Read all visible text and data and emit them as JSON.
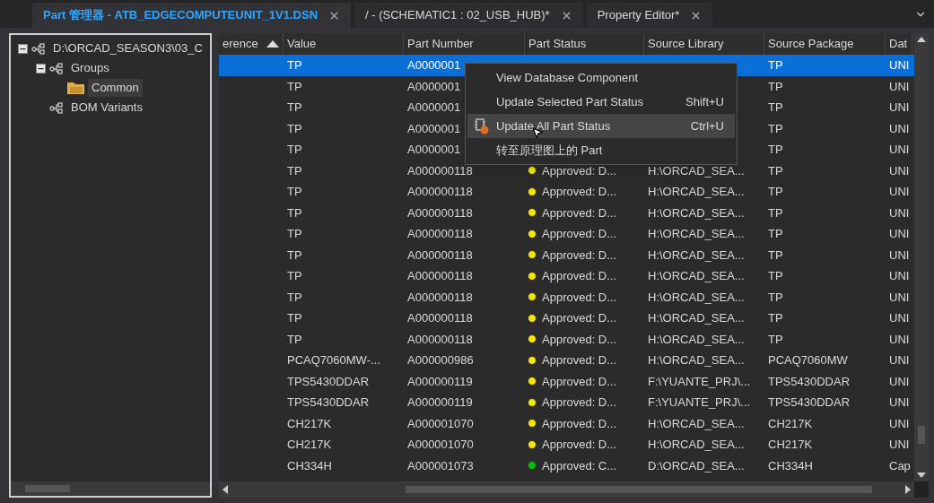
{
  "tabs": [
    {
      "label": "Part 管理器 - ATB_EDGECOMPUTEUNIT_1V1.DSN",
      "selected": true
    },
    {
      "label": "/ - (SCHEMATIC1 : 02_USB_HUB)*",
      "selected": false
    },
    {
      "label": "Property Editor*",
      "selected": false
    }
  ],
  "tree": [
    {
      "label": "D:\\ORCAD_SEASON3\\03_C",
      "kind": "node",
      "expanded": true,
      "selected": false,
      "children": [
        {
          "label": "Groups",
          "kind": "node",
          "expanded": true,
          "selected": false,
          "children": [
            {
              "label": "Common",
              "kind": "folder",
              "selected": true
            }
          ]
        },
        {
          "label": "BOM Variants",
          "kind": "node",
          "selected": false
        }
      ]
    }
  ],
  "table": {
    "columns": [
      "erence",
      "Value",
      "Part Number",
      "Part Status",
      "Source Library",
      "Source Package",
      "Dat"
    ],
    "rows": [
      {
        "selected": true,
        "value": "TP",
        "part_number": "A0000001",
        "source_package": "TP",
        "column_7": "UNI"
      },
      {
        "selected": false,
        "value": "TP",
        "part_number": "A0000001",
        "source_package": "TP",
        "column_7": "UNI"
      },
      {
        "selected": false,
        "value": "TP",
        "part_number": "A0000001",
        "source_package": "TP",
        "column_7": "UNI"
      },
      {
        "selected": false,
        "value": "TP",
        "part_number": "A0000001",
        "source_package": "TP",
        "column_7": "UNI"
      },
      {
        "selected": false,
        "value": "TP",
        "part_number": "A0000001",
        "source_package": "TP",
        "column_7": "UNI"
      },
      {
        "selected": false,
        "value": "TP",
        "part_number": "A000000118",
        "color": "#f5e600",
        "status": "Approved: D...",
        "source_library": "H:\\ORCAD_SEA...",
        "source_package": "TP",
        "column_7": "UNI"
      },
      {
        "selected": false,
        "value": "TP",
        "part_number": "A000000118",
        "color": "#f5e600",
        "status": "Approved: D...",
        "source_library": "H:\\ORCAD_SEA...",
        "source_package": "TP",
        "column_7": "UNI"
      },
      {
        "selected": false,
        "value": "TP",
        "part_number": "A000000118",
        "color": "#f5e600",
        "status": "Approved: D...",
        "source_library": "H:\\ORCAD_SEA...",
        "source_package": "TP",
        "column_7": "UNI"
      },
      {
        "selected": false,
        "value": "TP",
        "part_number": "A000000118",
        "color": "#f5e600",
        "status": "Approved: D...",
        "source_library": "H:\\ORCAD_SEA...",
        "source_package": "TP",
        "column_7": "UNI"
      },
      {
        "selected": false,
        "value": "TP",
        "part_number": "A000000118",
        "color": "#f5e600",
        "status": "Approved: D...",
        "source_library": "H:\\ORCAD_SEA...",
        "source_package": "TP",
        "column_7": "UNI"
      },
      {
        "selected": false,
        "value": "TP",
        "part_number": "A000000118",
        "color": "#f5e600",
        "status": "Approved: D...",
        "source_library": "H:\\ORCAD_SEA...",
        "source_package": "TP",
        "column_7": "UNI"
      },
      {
        "selected": false,
        "value": "TP",
        "part_number": "A000000118",
        "color": "#f5e600",
        "status": "Approved: D...",
        "source_library": "H:\\ORCAD_SEA...",
        "source_package": "TP",
        "column_7": "UNI"
      },
      {
        "selected": false,
        "value": "TP",
        "part_number": "A000000118",
        "color": "#f5e600",
        "status": "Approved: D...",
        "source_library": "H:\\ORCAD_SEA...",
        "source_package": "TP",
        "column_7": "UNI"
      },
      {
        "selected": false,
        "value": "TP",
        "part_number": "A000000118",
        "color": "#f5e600",
        "status": "Approved: D...",
        "source_library": "H:\\ORCAD_SEA...",
        "source_package": "TP",
        "column_7": "UNI"
      },
      {
        "selected": false,
        "value": "PCAQ7060MW-...",
        "part_number": "A000000986",
        "color": "#f5e600",
        "status": "Approved: D...",
        "source_library": "H:\\ORCAD_SEA...",
        "source_package": "PCAQ7060MW",
        "column_7": "UNI"
      },
      {
        "selected": false,
        "value": "TPS5430DDAR",
        "part_number": "A000000119",
        "color": "#f5e600",
        "status": "Approved: D...",
        "source_library": "F:\\YUANTE_PRJ\\...",
        "source_package": "TPS5430DDAR",
        "column_7": "UNI"
      },
      {
        "selected": false,
        "value": "TPS5430DDAR",
        "part_number": "A000000119",
        "color": "#f5e600",
        "status": "Approved: D...",
        "source_library": "F:\\YUANTE_PRJ\\...",
        "source_package": "TPS5430DDAR",
        "column_7": "UNI"
      },
      {
        "selected": false,
        "value": "CH217K",
        "part_number": "A000001070",
        "color": "#f5e600",
        "status": "Approved: D...",
        "source_library": "H:\\ORCAD_SEA...",
        "source_package": "CH217K",
        "column_7": "UNI"
      },
      {
        "selected": false,
        "value": "CH217K",
        "part_number": "A000001070",
        "color": "#f5e600",
        "status": "Approved: D...",
        "source_library": "H:\\ORCAD_SEA...",
        "source_package": "CH217K",
        "column_7": "UNI"
      },
      {
        "selected": false,
        "value": "CH334H",
        "part_number": "A000001073",
        "color": "#00c000",
        "status": "Approved: C...",
        "source_library": "D:\\ORCAD_SEA...",
        "source_package": "CH334H",
        "column_7": "Cap"
      }
    ]
  },
  "context_menu": [
    {
      "label": "View Database Component",
      "selected": false
    },
    {
      "label": "Update Selected Part Status",
      "shortcut": "Shift+U",
      "selected": false
    },
    {
      "label": "Update All Part Status",
      "shortcut": "Ctrl+U",
      "selected": true,
      "has_icon": true
    },
    {
      "label": "转至原理图上的 Part",
      "selected": false
    }
  ]
}
